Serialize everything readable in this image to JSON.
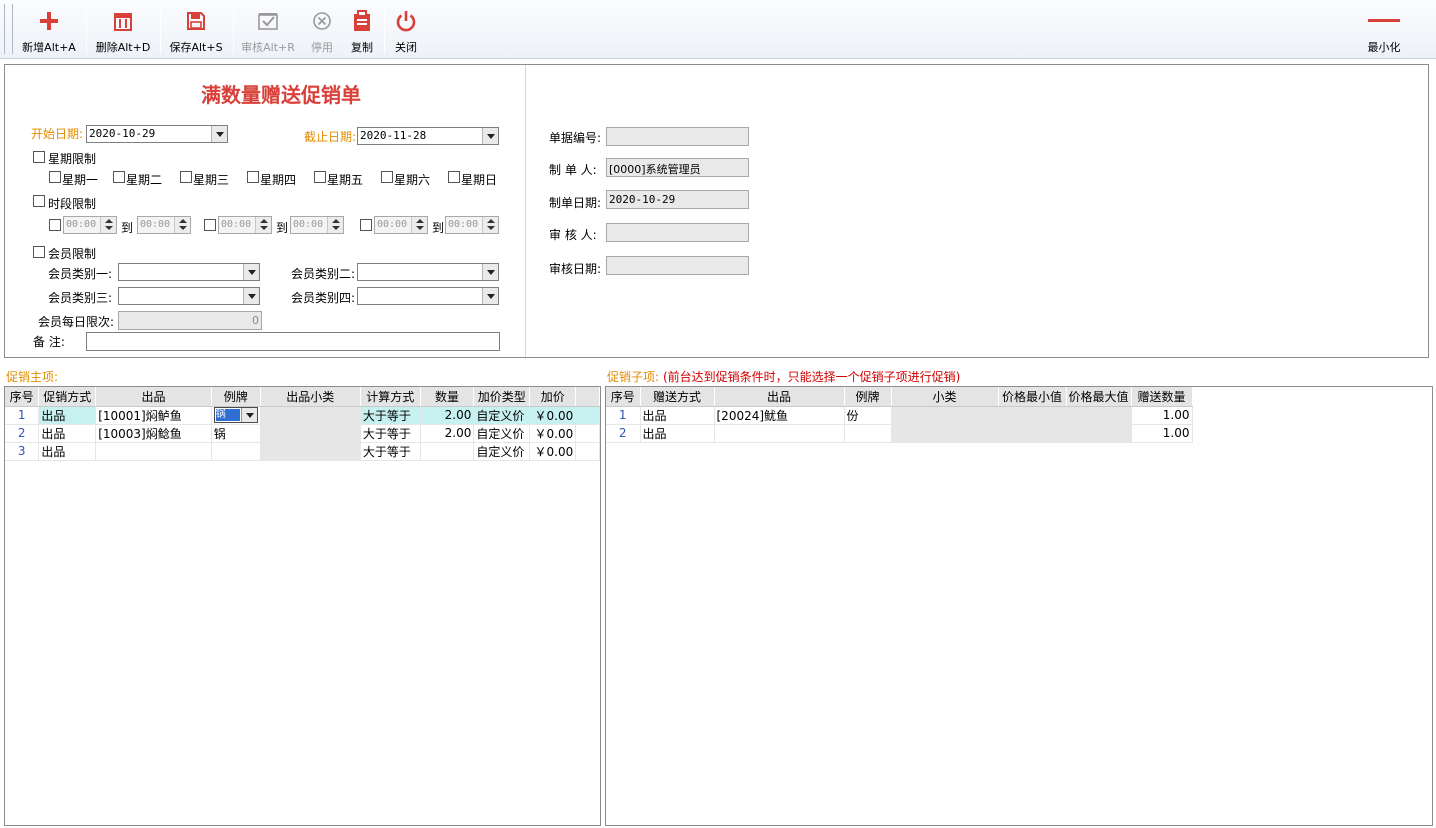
{
  "toolbar": {
    "add": "新增Alt+A",
    "delete": "删除Alt+D",
    "save": "保存Alt+S",
    "audit": "审核Alt+R",
    "disable": "停用",
    "copy": "复制",
    "close": "关闭",
    "minimize": "最小化",
    "accent": "#d9403a",
    "disabled_color": "#9a9a9a"
  },
  "form": {
    "title": "满数量赠送促销单",
    "start_date_label": "开始日期:",
    "start_date": "2020-10-29",
    "end_date_label": "截止日期:",
    "end_date": "2020-11-28",
    "week_limit_label": "星期限制",
    "weekdays": [
      "星期一",
      "星期二",
      "星期三",
      "星期四",
      "星期五",
      "星期六",
      "星期日"
    ],
    "time_limit_label": "时段限制",
    "time_to": "到",
    "time_value": "00:00",
    "member_limit_label": "会员限制",
    "member_type1_label": "会员类别一:",
    "member_type2_label": "会员类别二:",
    "member_type3_label": "会员类别三:",
    "member_type4_label": "会员类别四:",
    "member_daily_label": "会员每日限次:",
    "member_daily_value": "0",
    "remark_label": "备    注:",
    "remark_value": ""
  },
  "info": {
    "doc_no_label": "单据编号:",
    "doc_no": "",
    "maker_label": "制 单 人:",
    "maker": "[0000]系统管理员",
    "make_date_label": "制单日期:",
    "make_date": "2020-10-29",
    "auditor_label": "审 核 人:",
    "auditor": "",
    "audit_date_label": "审核日期:",
    "audit_date": ""
  },
  "main_grid": {
    "label": "促销主项:",
    "columns": [
      "序号",
      "促销方式",
      "出品",
      "例牌",
      "出品小类",
      "计算方式",
      "数量",
      "加价类型",
      "加价"
    ],
    "rows": [
      {
        "idx": "1",
        "mode": "出品",
        "item": "[10001]焖鲈鱼",
        "portion": "锅",
        "sub": "",
        "calc": "大于等于",
        "qty": "2.00",
        "price_type": "自定义价",
        "price": "￥0.00"
      },
      {
        "idx": "2",
        "mode": "出品",
        "item": "[10003]焖鲶鱼",
        "portion": "锅",
        "sub": "",
        "calc": "大于等于",
        "qty": "2.00",
        "price_type": "自定义价",
        "price": "￥0.00"
      },
      {
        "idx": "3",
        "mode": "出品",
        "item": "",
        "portion": "",
        "sub": "",
        "calc": "大于等于",
        "qty": "",
        "price_type": "自定义价",
        "price": "￥0.00"
      }
    ]
  },
  "sub_grid": {
    "label": "促销子项:",
    "note": "(前台达到促销条件时，只能选择一个促销子项进行促销)",
    "columns": [
      "序号",
      "赠送方式",
      "出品",
      "例牌",
      "小类",
      "价格最小值",
      "价格最大值",
      "赠送数量"
    ],
    "rows": [
      {
        "idx": "1",
        "mode": "出品",
        "item": "[20024]鱿鱼",
        "portion": "份",
        "sub": "",
        "min": "",
        "max": "",
        "qty": "1.00"
      },
      {
        "idx": "2",
        "mode": "出品",
        "item": "",
        "portion": "",
        "sub": "",
        "min": "",
        "max": "",
        "qty": "1.00"
      }
    ]
  }
}
